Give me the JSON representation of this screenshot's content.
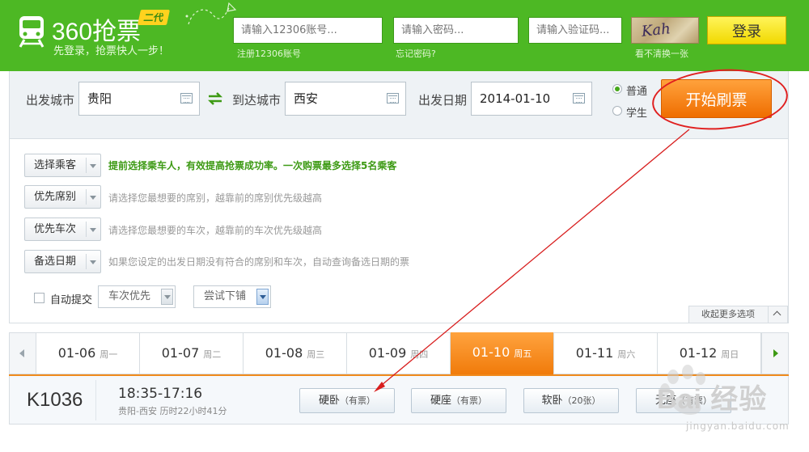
{
  "header": {
    "logo_name": "360抢票",
    "logo_badge": "二代",
    "slogan": "先登录，抢票快人一步！",
    "account_placeholder": "请输入12306账号...",
    "password_placeholder": "请输入密码...",
    "captcha_placeholder": "请输入验证码...",
    "register_hint": "注册12306账号",
    "forgot_hint": "忘记密码?",
    "captcha_text": "Kah",
    "captcha_refresh": "看不清换一张",
    "login_label": "登录"
  },
  "search": {
    "from_label": "出发城市",
    "from_value": "贵阳",
    "to_label": "到达城市",
    "to_value": "西安",
    "date_label": "出发日期",
    "date_value": "2014-01-10",
    "ticket_types": [
      "普通",
      "学生"
    ],
    "selected_ticket_type": "普通",
    "start_button": "开始刷票"
  },
  "options": {
    "passenger_button": "选择乘客",
    "passenger_hint": "提前选择乘车人，有效提高抢票成功率。一次购票最多选择5名乘客",
    "seat_button": "优先席别",
    "seat_hint": "请选择您最想要的席别，越靠前的席别优先级越高",
    "train_button": "优先车次",
    "train_hint": "请选择您最想要的车次，越靠前的车次优先级越高",
    "backup_button": "备选日期",
    "backup_hint": "如果您设定的出发日期没有符合的席别和车次，自动查询备选日期的票",
    "auto_submit_label": "自动提交",
    "priority_select": "车次优先",
    "berth_select": "尝试下铺",
    "collapse_label": "收起更多选项"
  },
  "dates": [
    {
      "date": "01-06",
      "weekday": "周一"
    },
    {
      "date": "01-07",
      "weekday": "周二"
    },
    {
      "date": "01-08",
      "weekday": "周三"
    },
    {
      "date": "01-09",
      "weekday": "周四"
    },
    {
      "date": "01-10",
      "weekday": "周五"
    },
    {
      "date": "01-11",
      "weekday": "周六"
    },
    {
      "date": "01-12",
      "weekday": "周日"
    }
  ],
  "active_date": "01-10",
  "train": {
    "number": "K1036",
    "time": "18:35-17:16",
    "route": "贵阳-西安 历时22小时41分",
    "seats": [
      {
        "name": "硬卧",
        "status": "（有票）"
      },
      {
        "name": "硬座",
        "status": "（有票）"
      },
      {
        "name": "软卧",
        "status": "（20张）"
      },
      {
        "name": "无座",
        "status": "（有票）"
      }
    ]
  },
  "watermark": {
    "brand": "Bai 经验",
    "url": "jingyan.baidu.com"
  },
  "colors": {
    "header_green": "#4db824",
    "accent_orange": "#f07a0a",
    "annotation_red": "#e02020",
    "login_yellow": "#f1d900"
  }
}
